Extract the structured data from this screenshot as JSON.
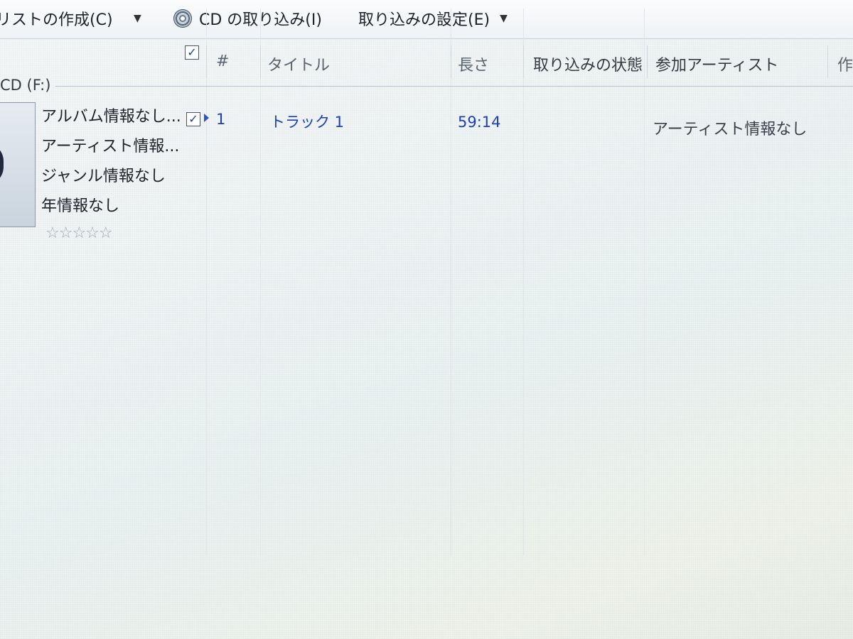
{
  "toolbar": {
    "create_playlist_label": "リストの作成(C)",
    "rip_cd_label": "CD の取り込み(I)",
    "rip_settings_label": "取り込みの設定(E)",
    "dropdown_glyph": "▼"
  },
  "columns": {
    "number": "#",
    "title": "タイトル",
    "length": "長さ",
    "rip_status": "取り込みの状態",
    "contributing_artist": "参加アーティスト",
    "composer_partial": "作"
  },
  "group": {
    "label": "CD (F:)"
  },
  "album": {
    "name": "アルバム情報なし...",
    "artist": "アーティスト情報...",
    "genre": "ジャンル情報なし",
    "year": "年情報なし",
    "rating_stars": 0,
    "rating_glyphs": "☆☆☆☆☆"
  },
  "track": {
    "checked": true,
    "number": "1",
    "title": "トラック 1",
    "length": "59:14",
    "rip_status": "",
    "contributing_artist": "アーティスト情報なし"
  },
  "colors": {
    "track_text": "#1d3fb0",
    "header_text": "#5a6470",
    "group_line": "#b8c6d4"
  }
}
